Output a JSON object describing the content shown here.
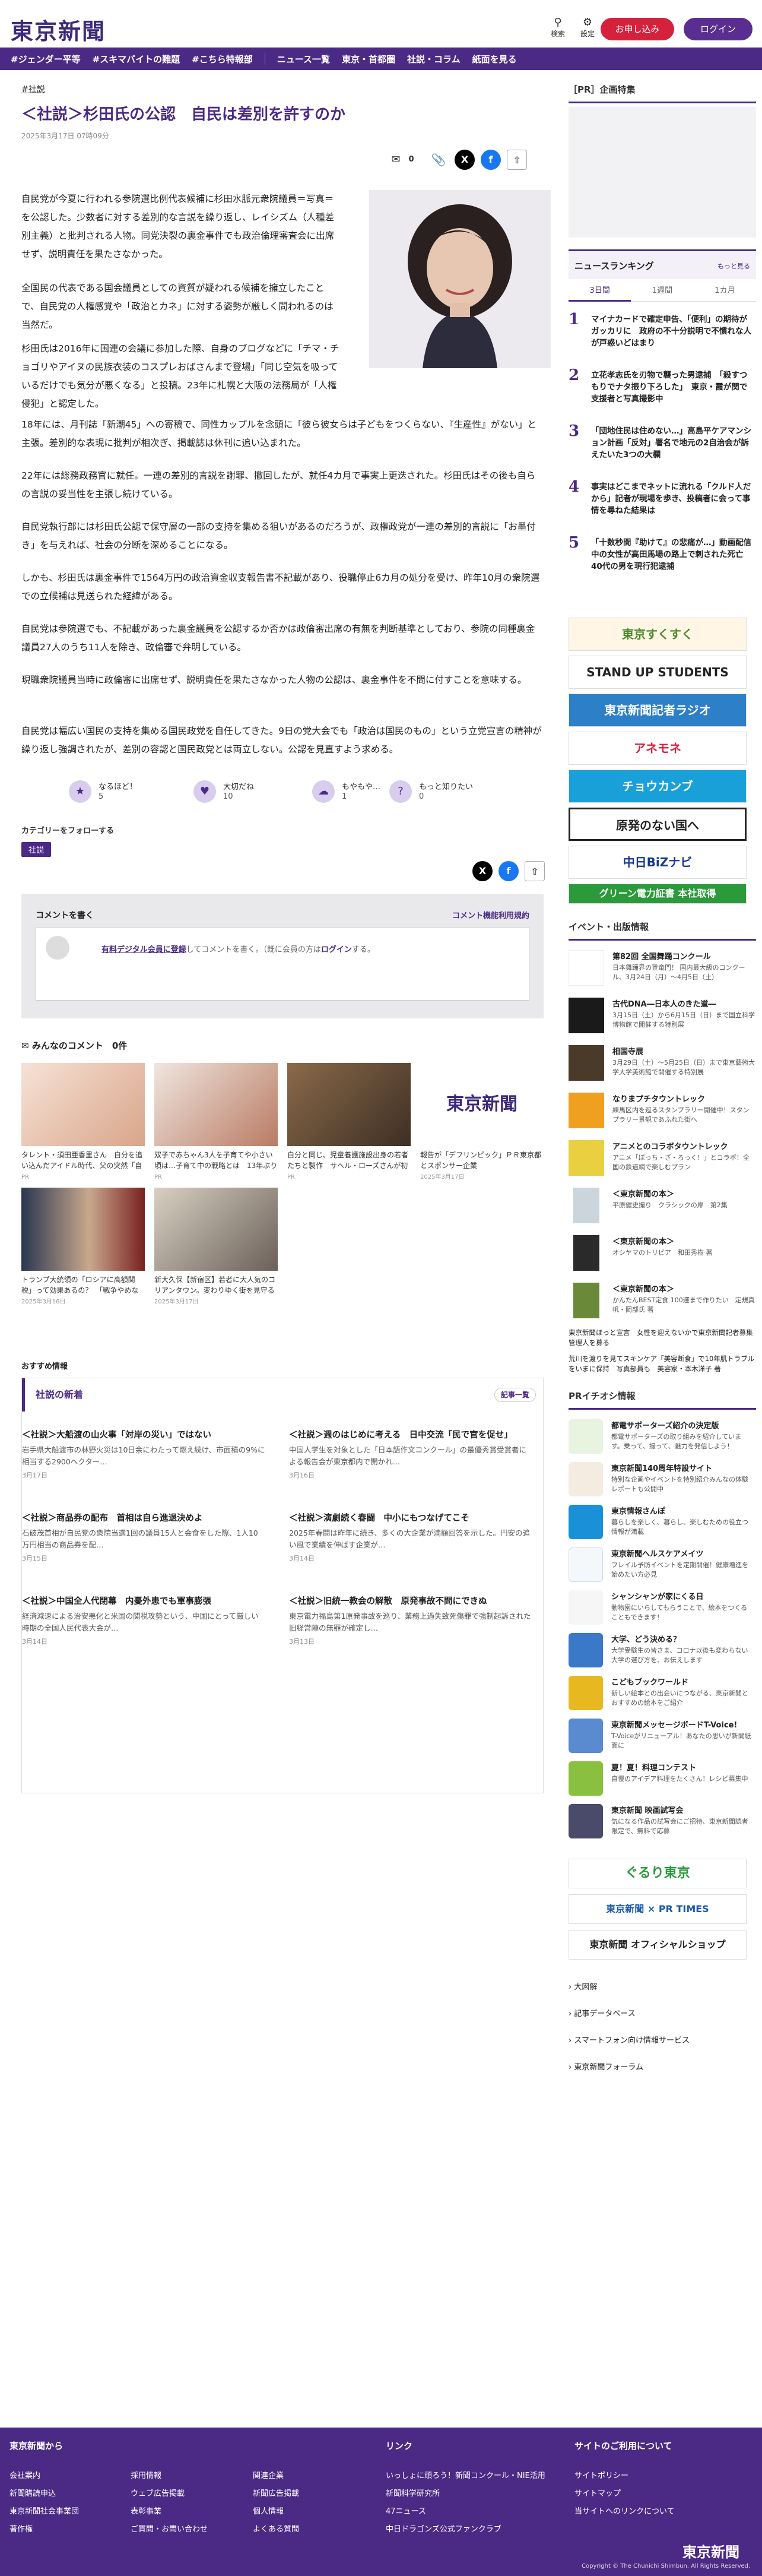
{
  "header": {
    "logo": "東京新聞",
    "search": "検索",
    "settings": "設定",
    "register": "お申し込み",
    "login": "ログイン"
  },
  "nav": [
    "#ジェンダー平等",
    "#スキマバイトの難題",
    "#こちら特報部",
    "ニュース一覧",
    "東京・首都圏",
    "社説・コラム",
    "紙面を見る"
  ],
  "article": {
    "tag": "#社説",
    "title": "＜社説＞杉田氏の公認　自民は差別を許すのか",
    "date": "2025年3月17日 07時09分",
    "share_count": "0",
    "paragraphs": [
      "自民党が今夏に行われる参院選比例代表候補に杉田水脈元衆院議員＝写真＝を公認した。少数者に対する差別的な言説を繰り返し、レイシズム（人種差別主義）と批判される人物。同党決裂の裏金事件でも政治倫理審査会に出席せず、説明責任を果たさなかった。",
      "全国民の代表である国会議員としての資質が疑われる候補を擁立したことで、自民党の人権感覚や「政治とカネ」に対する姿勢が厳しく問われるのは当然だ。",
      "杉田氏は2016年に国連の会議に参加した際、自身のブログなどに「チマ・チョゴリやアイヌの民族衣装のコスプレおばさんまで登場」「同じ空気を吸っているだけでも気分が悪くなる」と投稿。23年に札幌と大阪の法務局が「人権侵犯」と認定した。",
      "18年には、月刊誌「新潮45」への寄稿で、同性カップルを念頭に「彼ら彼女らは子どもをつくらない、『生産性』がない」と主張。差別的な表現に批判が相次ぎ、掲載誌は休刊に追い込まれた。",
      "22年には総務政務官に就任。一連の差別的言説を謝罪、撤回したが、就任4カ月で事実上更迭された。杉田氏はその後も自らの言説の妥当性を主張し続けている。",
      "自民党執行部には杉田氏公認で保守層の一部の支持を集める狙いがあるのだろうが、政権政党が一連の差別的言説に「お墨付き」を与えれば、社会の分断を深めることになる。",
      "しかも、杉田氏は裏金事件で1564万円の政治資金収支報告書不記載があり、役職停止6カ月の処分を受け、昨年10月の衆院選での立候補は見送られた経緯がある。",
      "自民党は参院選でも、不記載があった裏金議員を公認するか否かは政倫審出席の有無を判断基準としており、参院の同種裏金議員27人のうち11人を除き、政倫審で弁明している。",
      "現職衆院議員当時に政倫審に出席せず、説明責任を果たさなかった人物の公認は、裏金事件を不問に付すことを意味する。",
      "自民党は幅広い国民の支持を集める国民政党を自任してきた。9日の党大会でも「政治は国民のもの」という立党宣言の精神が繰り返し強調されたが、差別の容認と国民政党とは両立しない。公認を見直すよう求める。"
    ],
    "reactions": [
      {
        "label": "なるほど！",
        "count": "5"
      },
      {
        "label": "大切だね",
        "count": "10"
      },
      {
        "label": "もやもや…",
        "count": "1"
      },
      {
        "label": "もっと知りたい",
        "count": "0"
      }
    ],
    "category_follow": "カテゴリーをフォローする",
    "category": "社説"
  },
  "comments": {
    "write": "コメントを書く",
    "rules": "コメント機能利用規約",
    "prompt_link": "有料デジタル会員に登録",
    "prompt_rest": "してコメントを書く。（既に会員の方は",
    "prompt_login": "ログイン",
    "prompt_end": "する。",
    "all": "みんなのコメント",
    "count": "0件"
  },
  "cards": [
    {
      "title": "タレント・須田亜香里さん　自分を追い込んだアイドル時代、父の突然「自分のこと好きか？」…",
      "date": "PR"
    },
    {
      "title": "双子で赤ちゃん3人を子育てや小さい頃は…子育て中の戦略とは　13年ぶり「おはよう日本」に…",
      "date": "PR"
    },
    {
      "title": "自分と同じ、児童養護施設出身の若者たちと製作　サヘル・ローズさんが初監督映画「花束」…",
      "date": "PR"
    },
    {
      "title": "報告が「デフリンピック」ＰＲ東京都とスポンサー企業",
      "date": "2025年3月17日"
    },
    {
      "title": "トランプ大統領の「ロシアに高額関税」って効果あるの？　「戦争やめなければ制裁」プーチ…",
      "date": "2025年3月16日"
    },
    {
      "title": "新大久保【新宿区】若者に大人気のコリアンタウン。変わりゆく街を見守る神社をお参りし…",
      "date": "2025年3月17日"
    }
  ],
  "osusume": "おすすめ情報",
  "editorial": {
    "header": "社説の新着",
    "more": "記事一覧",
    "items": [
      {
        "title": "＜社説＞大船渡の山火事「対岸の災い」ではない",
        "summary": "岩手県大船渡市の林野火災は10日余にわたって燃え続け、市面積の9%に相当する2900ヘクター…",
        "date": "3月17日"
      },
      {
        "title": "＜社説＞週のはじめに考える　日中交流「民で官を促せ」",
        "summary": "中国人学生を対象とした「日本語作文コンクール」の最優秀賞受賞者による報告会が東京都内で開かれ…",
        "date": "3月16日"
      },
      {
        "title": "＜社説＞商品券の配布　首相は自ら進退決めよ",
        "summary": "石破茂首相が自民党の衆院当選1回の議員15人と会食をした際、1人10万円相当の商品券を配…",
        "date": "3月15日"
      },
      {
        "title": "＜社説＞演劇続く春闘　中小にもつなげてこそ",
        "summary": "2025年春闘は昨年に続き、多くの大企業が満額回答を示した。円安の追い風で業績を伸ばす企業が…",
        "date": "3月14日"
      },
      {
        "title": "＜社説＞中国全人代閉幕　内憂外患でも軍事膨張",
        "summary": "経済減速による治安悪化と米国の関税攻勢という、中国にとって厳しい時期の全国人民代表大会が…",
        "date": "3月14日"
      },
      {
        "title": "＜社説＞旧統一教会の解散　原発事故不問にできぬ",
        "summary": "東京電力福島第1原発事故を巡り、業務上過失致死傷罪で強制起訴された旧経営陣の無罪が確定し…",
        "date": "3月13日"
      }
    ]
  },
  "sidebar": {
    "pr_title": "［PR］企画特集",
    "ranking_title": "ニュースランキング",
    "ranking_more": "もっと見る",
    "ranking_tabs": [
      "3日間",
      "1週間",
      "1カ月"
    ],
    "ranking": [
      {
        "n": "1",
        "text": "マイナカードで確定申告、「便利」の期待がガッカリに　政府の不十分説明で不慣れな人が戸惑いどはまり"
      },
      {
        "n": "2",
        "text": "立花孝志氏を刃物で襲った男逮捕　「殺すつもりでナタ振り下ろした」　東京・霞が関で支援者と写真撮影中"
      },
      {
        "n": "3",
        "text": "「団地住民は住めない…」高島平ケアマンション計画「反対」署名で地元の2自治会が訴えたいた3つの大欄"
      },
      {
        "n": "4",
        "text": "事実はどこまでネットに流れる「クルド人だから」記者が現場を歩き、投稿者に会って事情を尋ねた結果は"
      },
      {
        "n": "5",
        "text": "「十数秒間『助けて』の悲痛が…」動画配信中の女性が高田馬場の路上で刺された死亡 40代の男を現行犯逮捕"
      }
    ],
    "banners": [
      "東京すくすく",
      "STAND UP STUDENTS",
      "東京新聞記者ラジオ",
      "アネモネ",
      "チョウカンブ",
      "原発のない国へ",
      "中日BiZナビ",
      "グリーン電力証書 本社取得"
    ],
    "events_title": "イベント・出版情報",
    "events": [
      {
        "title": "第82回 全国舞踊コンクール",
        "sub": "日本舞踊界の登竜門！ 国内最大級のコンクール、3月24日（月）〜4月5日（土）"
      },
      {
        "title": "古代DNA―日本人のきた道―",
        "sub": "3月15日（土）から6月15日（日）まで国立科学博物館で開催する特別展"
      },
      {
        "title": "相国寺展",
        "sub": "3月29日（土）〜5月25日（日）まで東京藝術大学大学美術館で開催する特別展"
      },
      {
        "title": "なりまプチタウントレック",
        "sub": "練馬区内を巡るスタンプラリー開催中！スタンプラリー景観であふれた街へ"
      },
      {
        "title": "アニメとのコラボタウントレック",
        "sub": "アニメ「ぼっち・ざ・ろっく！」とコラボ！全国の鉄道網で楽しむプラン"
      },
      {
        "title": "＜東京新聞の本＞",
        "sub": "平原健史撮り　クラシックの扉　第2集"
      },
      {
        "title": "＜東京新聞の本＞",
        "sub": "オシヤマのトリビア　和田秀樹 著"
      },
      {
        "title": "＜東京新聞の本＞",
        "sub": "かんたんBEST定食 100選まで作りたい　定規真帆・岡部氏 著"
      }
    ],
    "events_links": [
      "東京新聞ほっと宣言　女性を迎えないかで東京新聞記者募集　管理人を募る",
      "荒川を渡りを見てスキンケア「美容断食」で10年肌トラブルをいまに保持　写真部員も　美容家・本木洋子 著"
    ],
    "pr_info_title": "PRイチオシ情報",
    "pr_items": [
      {
        "title": "都電サポーターズ紹介の決定版",
        "sub": "都電サポーターズの取り組みを紹介しています。乗って、撮って、魅力を発信しよう！"
      },
      {
        "title": "東京新聞140周年特設サイト",
        "sub": "特別な企画やイベントを特別紹介みんなの体験レポートも公開中"
      },
      {
        "title": "東京情報さんぽ",
        "sub": "暮らしを楽しく、暮らし、楽しむための役立つ情報が満載"
      },
      {
        "title": "東京新聞ヘルスケアメイツ",
        "sub": "フレイル予防イベントを定期開催！健康増進を始めたい方必見"
      },
      {
        "title": "シャンシャンが家にくる日",
        "sub": "動物園にいらしてもらうことで、絵本をつくることもできます！"
      },
      {
        "title": "大学、どう決める？",
        "sub": "大学受験生の皆さま、コロナ以後も変わらない大学の選び方を、お伝えします"
      },
      {
        "title": "こどもブックワールド",
        "sub": "新しい絵本との出会いにつながる、東京新聞とおすすめの絵本をご紹介"
      },
      {
        "title": "東京新聞メッセージボードT-Voice!",
        "sub": "T-Voiceがリニューアル！あなたの思いが新聞紙面に"
      },
      {
        "title": "夏！夏！料理コンテスト",
        "sub": "自慢のアイデア料理をたくさん！レシピ募集中"
      },
      {
        "title": "東京新聞 映画試写会",
        "sub": "気になる作品の試写会にご招待、東京新聞読者限定で、無料で応募"
      }
    ],
    "bottom_banners": [
      "ぐるり東京",
      "東京新聞 × PR TIMES",
      "東京新聞 オフィシャルショップ"
    ],
    "links": [
      "大図解",
      "記事データベース",
      "スマートフォン向け情報サービス",
      "東京新聞フォーラム"
    ]
  },
  "footer": {
    "col1_title": "東京新聞から",
    "col1": [
      "会社案内",
      "採用情報",
      "関連企業",
      "新聞購読申込",
      "ウェブ広告掲載",
      "新聞広告掲載",
      "東京新聞社会事業団",
      "表彰事業",
      "個人情報",
      "著作権",
      "ご質問・お問い合わせ",
      "よくある質問"
    ],
    "col2_title": "リンク",
    "col2": [
      "いっしょに頑ろう！新聞コンクール・NIE活用",
      "新聞科学研究所",
      "47ニュース",
      "中日ドラゴンズ公式ファンクラブ"
    ],
    "col3_title": "サイトのご利用について",
    "col3": [
      "サイトポリシー",
      "サイトマップ",
      "当サイトへのリンクについて"
    ],
    "logo": "東京新聞",
    "copyright": "Copyright © The Chunichi Shimbun, All Rights Reserved."
  }
}
